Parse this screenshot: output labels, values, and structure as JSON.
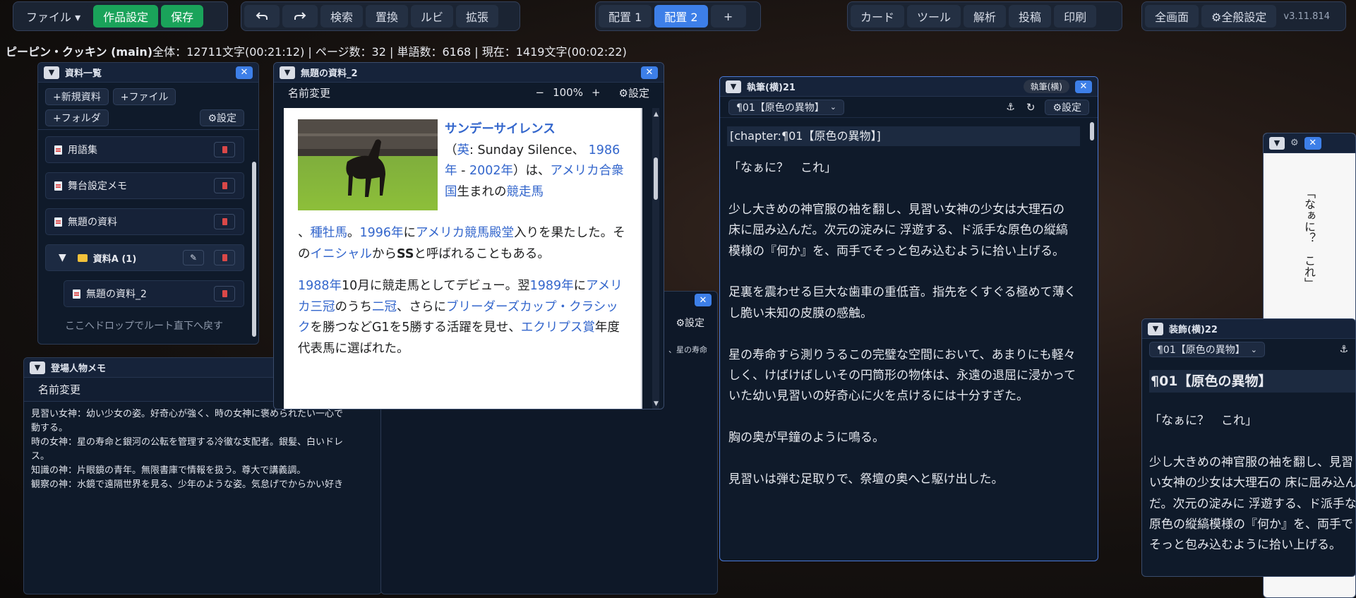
{
  "toolbar": {
    "file": "ファイル ▾",
    "work_settings": "作品設定",
    "save": "保存",
    "undo_icon": "undo-icon",
    "redo_icon": "redo-icon",
    "search": "検索",
    "replace": "置換",
    "ruby": "ルビ",
    "extend": "拡張",
    "layout1": "配置 1",
    "layout2": "配置 2",
    "add_layout": "+",
    "card": "カード",
    "tool": "ツール",
    "analysis": "解析",
    "post": "投稿",
    "print": "印刷",
    "fullscreen": "全画面",
    "general_settings": "⚙全般設定",
    "version": "v3.11.814"
  },
  "status": {
    "title": "ピーピン・クッキン (main)",
    "text": "全体：12711文字(00:21:12) | ページ数：32 | 単語数：6168 | 現在：1419文字(00:02:22)"
  },
  "materials": {
    "title": "資料一覧",
    "new_material": "+新規資料",
    "add_file": "+ファイル",
    "add_folder": "+フォルダ",
    "settings": "⚙設定",
    "items": [
      "用語集",
      "舞台設定メモ",
      "無題の資料"
    ],
    "folder": "資料A (1)",
    "child": "無題の資料_2",
    "drop_hint": "ここへドロップでルート直下へ戻す"
  },
  "viewer": {
    "title": "無題の資料_2",
    "rename": "名前変更",
    "zoom_minus": "−",
    "zoom": "100%",
    "zoom_plus": "+",
    "settings": "⚙設定"
  },
  "wiki": {
    "t1": "サンデーサイレンス",
    "p1a": "（",
    "l_ei": "英",
    "p1b": ": Sunday Silence、",
    "l_1986": "1986年",
    "p1c": " - ",
    "l_2002": "2002年",
    "p1d": "）は、",
    "l_usa": "アメリカ合衆国",
    "p1e": "生まれの",
    "l_race": "競走馬",
    "p1f": "、",
    "l_stud": "種牡馬",
    "p1g": "。",
    "l_1996": "1996年",
    "p1h": "に",
    "l_hof": "アメリカ競馬殿堂",
    "p1i": "入りを果たした。その",
    "l_init": "イニシャル",
    "p1j": "から",
    "p1k": "SS",
    "p1l": "と呼ばれることもある。",
    "l_1988": "1988年",
    "p2a": "10月に競走馬としてデビュー。翌",
    "l_1989": "1989年",
    "p2b": "に",
    "l_triple": "アメリカ三冠",
    "p2c": "のうち",
    "l_two": "二冠",
    "p2d": "、さらに",
    "l_bc": "ブリーダーズカップ・クラシック",
    "p2e": "を勝つなどG1を5勝する活躍を見せ、",
    "l_eclipse": "エクリプス賞",
    "p2f": "年度代表馬に選ばれた。"
  },
  "hidden_panel": {
    "settings": "⚙設定",
    "snippet": "、星の寿命"
  },
  "characters": {
    "title": "登場人物メモ",
    "rename": "名前変更",
    "lines": [
      "見習い女神：幼い少女の姿。好奇心が強く、時の女神に褒められたい一心で",
      "動する。",
      "時の女神：星の寿命と銀河の公転を管理する冷徹な支配者。銀髪、白いドレ",
      "ス。",
      "知識の神：片眼鏡の青年。無限書庫で情報を扱う。尊大で講義調。",
      "観察の神：水鏡で遠隔世界を見る、少年のような姿。気怠げでからかい好き"
    ]
  },
  "editor": {
    "title": "執筆(横)21",
    "badge": "執筆(横)",
    "chapter_select": "¶01【原色の異物】",
    "anchor_icon": "anchor-icon",
    "refresh_icon": "refresh-icon",
    "settings": "⚙設定",
    "tag_line": "[chapter:¶01【原色の異物】]",
    "body": "「なぁに？　これ」\n\n少し大きめの神官服の袖を翻し、見習い女神の少女は大理石の 床に屈み込んだ。次元の淀みに 浮遊する、ド派手な原色の縦縞模様の『何か』を、両手でそっと包み込むように拾い上げる。\n\n足裏を震わせる巨大な歯車の重低音。指先をくすぐる極めて薄くし脆い未知の皮膜の感触。\n\n星の寿命すら測りうるこの完璧な空間において、あまりにも軽々しく、けばけばしいその円筒形の物体は、永遠の退屈に浸かっていた幼い見習いの好奇心に火を点けるには十分すぎた。\n\n胸の奥が早鐘のように鳴る。\n\n見習いは弾む足取りで、祭壇の奥へと駆け出した。"
  },
  "vertical": {
    "settings_icon": "⚙",
    "text": "「なぁに？　これ」"
  },
  "decor": {
    "title": "装飾(横)22",
    "chapter_select": "¶01【原色の異物】",
    "heading": "¶01【原色の異物】",
    "body": "「なぁに？　これ」\n\n少し大きめの神官服の袖を翻し、見習い女神の少女は大理石の 床に屈み込んだ。次元の淀みに 浮遊する、ド派手な原色の縦縞模様の『何か』を、両手でそっと包み込むように拾い上げる。"
  }
}
